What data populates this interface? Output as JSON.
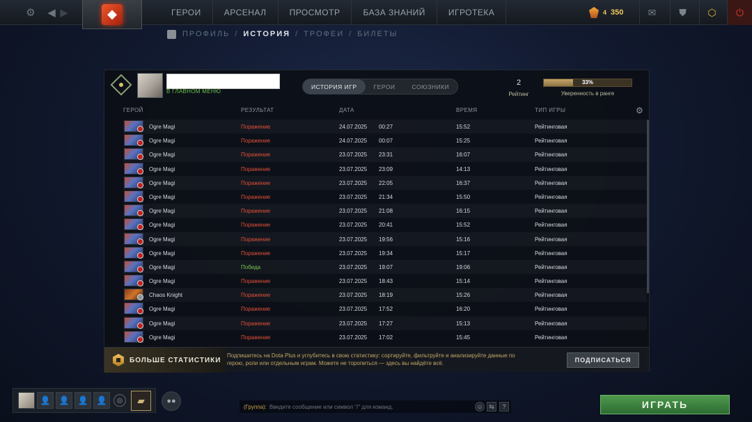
{
  "topbar": {
    "nav": [
      "ГЕРОИ",
      "АРСЕНАЛ",
      "ПРОСМОТР",
      "БАЗА ЗНАНИЙ",
      "ИГРОТЕКА"
    ],
    "shards": "4",
    "shards_count": "350",
    "icons": [
      "gear-icon",
      "back-icon",
      "forward-icon",
      "dota-logo",
      "mail-icon",
      "armory-icon",
      "dota-plus-icon",
      "power-icon"
    ]
  },
  "subnav": {
    "items": [
      "ПРОФИЛЬ",
      "ИСТОРИЯ",
      "ТРОФЕИ",
      "БИЛЕТЫ"
    ],
    "separator": "/",
    "active": "ИСТОРИЯ"
  },
  "profile": {
    "status": "В ГЛАВНОМ МЕНЮ",
    "tabs": [
      "ИСТОРИЯ ИГР",
      "ГЕРОИ",
      "СОЮЗНИКИ"
    ],
    "rating_value": "2",
    "rating_label": "Рейтинг",
    "confidence_value": "33%",
    "confidence_fraction": 0.33,
    "confidence_label": "Уверенность в ранге"
  },
  "table": {
    "headers": [
      "ГЕРОЙ",
      "РЕЗУЛЬТАТ",
      "ДАТА",
      "ВРЕМЯ",
      "ТИП ИГРЫ"
    ],
    "rows": [
      {
        "hero": "Ogre Magi",
        "result": "Поражение",
        "date": "24.07.2025",
        "time": "00:27",
        "duration": "15:52",
        "type": "Рейтинговая"
      },
      {
        "hero": "Ogre Magi",
        "result": "Поражение",
        "date": "24.07.2025",
        "time": "00:07",
        "duration": "15:25",
        "type": "Рейтинговая"
      },
      {
        "hero": "Ogre Magi",
        "result": "Поражение",
        "date": "23.07.2025",
        "time": "23:31",
        "duration": "16:07",
        "type": "Рейтинговая"
      },
      {
        "hero": "Ogre Magi",
        "result": "Поражение",
        "date": "23.07.2025",
        "time": "23:09",
        "duration": "14:13",
        "type": "Рейтинговая"
      },
      {
        "hero": "Ogre Magi",
        "result": "Поражение",
        "date": "23.07.2025",
        "time": "22:05",
        "duration": "16:37",
        "type": "Рейтинговая"
      },
      {
        "hero": "Ogre Magi",
        "result": "Поражение",
        "date": "23.07.2025",
        "time": "21:34",
        "duration": "15:50",
        "type": "Рейтинговая"
      },
      {
        "hero": "Ogre Magi",
        "result": "Поражение",
        "date": "23.07.2025",
        "time": "21:08",
        "duration": "16:15",
        "type": "Рейтинговая"
      },
      {
        "hero": "Ogre Magi",
        "result": "Поражение",
        "date": "23.07.2025",
        "time": "20:41",
        "duration": "15:52",
        "type": "Рейтинговая"
      },
      {
        "hero": "Ogre Magi",
        "result": "Поражение",
        "date": "23.07.2025",
        "time": "19:56",
        "duration": "15:16",
        "type": "Рейтинговая"
      },
      {
        "hero": "Ogre Magi",
        "result": "Поражение",
        "date": "23.07.2025",
        "time": "19:34",
        "duration": "15:17",
        "type": "Рейтинговая"
      },
      {
        "hero": "Ogre Magi",
        "result": "Победа",
        "date": "23.07.2025",
        "time": "19:07",
        "duration": "19:06",
        "type": "Рейтинговая"
      },
      {
        "hero": "Ogre Magi",
        "result": "Поражение",
        "date": "23.07.2025",
        "time": "18:43",
        "duration": "15:14",
        "type": "Рейтинговая"
      },
      {
        "hero": "Chaos Knight",
        "result": "Поражение",
        "date": "23.07.2025",
        "time": "18:19",
        "duration": "15:26",
        "type": "Рейтинговая"
      },
      {
        "hero": "Ogre Magi",
        "result": "Поражение",
        "date": "23.07.2025",
        "time": "17:52",
        "duration": "16:20",
        "type": "Рейтинговая"
      },
      {
        "hero": "Ogre Magi",
        "result": "Поражение",
        "date": "23.07.2025",
        "time": "17:27",
        "duration": "15:13",
        "type": "Рейтинговая"
      },
      {
        "hero": "Ogre Magi",
        "result": "Поражение",
        "date": "23.07.2025",
        "time": "17:02",
        "duration": "15:45",
        "type": "Рейтинговая"
      }
    ],
    "colors": {
      "loss": "#e0503a",
      "win": "#7ac94d",
      "ogre": "#5a72c0",
      "chaos": "#8a3a18"
    }
  },
  "promo": {
    "title": "БОЛЬШЕ СТАТИСТИКИ",
    "text": "Подпишитесь на Dota Plus и углубитесь в свою статистику: сортируйте, фильтруйте и анализируйте данные по герою, роли или отдельным играм. Можете не торопиться — здесь вы найдёте всё.",
    "button": "ПОДПИСАТЬСЯ"
  },
  "chat": {
    "channel": "(Группа):",
    "placeholder": "Введите сообщение или символ \"/\" для команд."
  },
  "play_button": "ИГРАТЬ"
}
